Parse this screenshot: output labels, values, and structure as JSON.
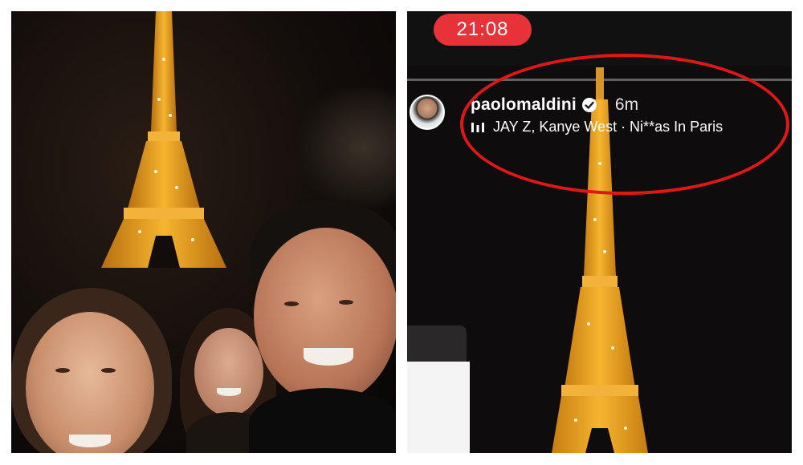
{
  "left_photo": {
    "description_icon": "eiffel-tower-icon"
  },
  "story": {
    "status_time": "21:08",
    "username": "paolomaldini",
    "verified_icon": "verified-badge-icon",
    "time_ago": "6m",
    "music_icon": "music-bars-icon",
    "music_text": "JAY Z, Kanye West · Ni**as In Paris",
    "progress": 0.0
  },
  "colors": {
    "time_pill": "#e8323a",
    "highlight_ellipse": "#e01717",
    "tower_gold": "#f0a11b"
  }
}
